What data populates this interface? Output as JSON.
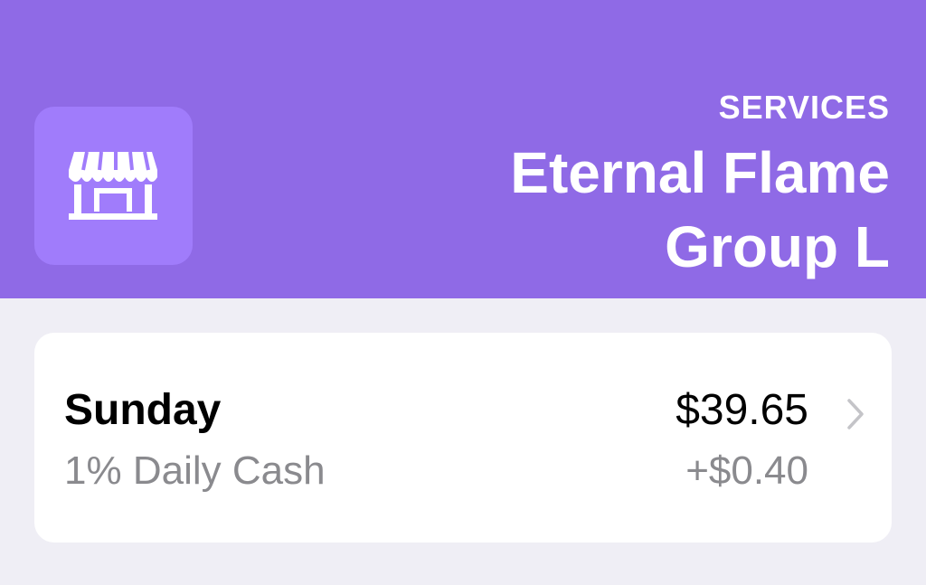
{
  "header": {
    "background_color": "#8f6ae6",
    "icon": "storefront-icon",
    "icon_tile_color": "#a07cfb",
    "category": "SERVICES",
    "merchant_name": "Eternal Flame Group L"
  },
  "transaction": {
    "day": "Sunday",
    "amount": "$39.65",
    "cash_label": "1% Daily Cash",
    "cash_amount": "+$0.40",
    "disclosure_icon": "chevron-right-icon"
  }
}
